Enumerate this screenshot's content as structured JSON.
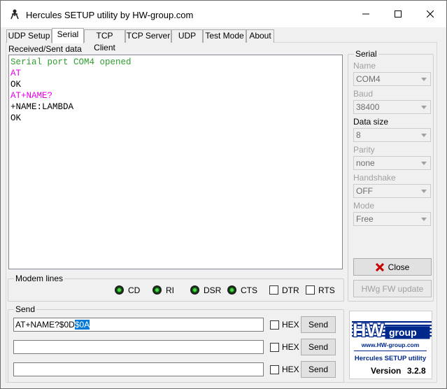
{
  "window": {
    "title": "Hercules SETUP utility by HW-group.com"
  },
  "tabs": [
    {
      "label": "UDP Setup"
    },
    {
      "label": "Serial"
    },
    {
      "label": "TCP Client"
    },
    {
      "label": "TCP Server"
    },
    {
      "label": "UDP"
    },
    {
      "label": "Test Mode"
    },
    {
      "label": "About"
    }
  ],
  "active_tab": "Serial",
  "received": {
    "label": "Received/Sent data",
    "lines": [
      {
        "text": "Serial port COM4 opened",
        "color": "#2e9e2e"
      },
      {
        "text": "AT",
        "color": "#e800e8"
      },
      {
        "text": "OK",
        "color": "#000000"
      },
      {
        "text": "AT+NAME?",
        "color": "#e800e8"
      },
      {
        "text": "+NAME:LAMBDA",
        "color": "#000000"
      },
      {
        "text": "OK",
        "color": "#000000"
      }
    ]
  },
  "serial": {
    "title": "Serial",
    "name_label": "Name",
    "name_value": "COM4",
    "baud_label": "Baud",
    "baud_value": "38400",
    "datasize_label": "Data size",
    "datasize_value": "8",
    "parity_label": "Parity",
    "parity_value": "none",
    "handshake_label": "Handshake",
    "handshake_value": "OFF",
    "mode_label": "Mode",
    "mode_value": "Free",
    "close_label": "Close",
    "hwg_update_label": "HWg FW update"
  },
  "modem": {
    "title": "Modem lines",
    "cd": "CD",
    "ri": "RI",
    "dsr": "DSR",
    "cts": "CTS",
    "dtr": "DTR",
    "rts": "RTS"
  },
  "send": {
    "title": "Send",
    "rows": [
      {
        "value_plain": "AT+NAME?$0D",
        "value_selected": "$0A",
        "hex_label": "HEX",
        "button": "Send"
      },
      {
        "value_plain": "",
        "value_selected": "",
        "hex_label": "HEX",
        "button": "Send"
      },
      {
        "value_plain": "",
        "value_selected": "",
        "hex_label": "HEX",
        "button": "Send"
      }
    ]
  },
  "logo": {
    "hw": "HW",
    "group": "group",
    "url": "www.HW-group.com",
    "product": "Hercules SETUP utility",
    "version_label": "Version",
    "version": "3.2.8"
  },
  "colors": {
    "accent": "#0078d7",
    "logo_blue": "#00288c",
    "close_x": "#c80000"
  }
}
